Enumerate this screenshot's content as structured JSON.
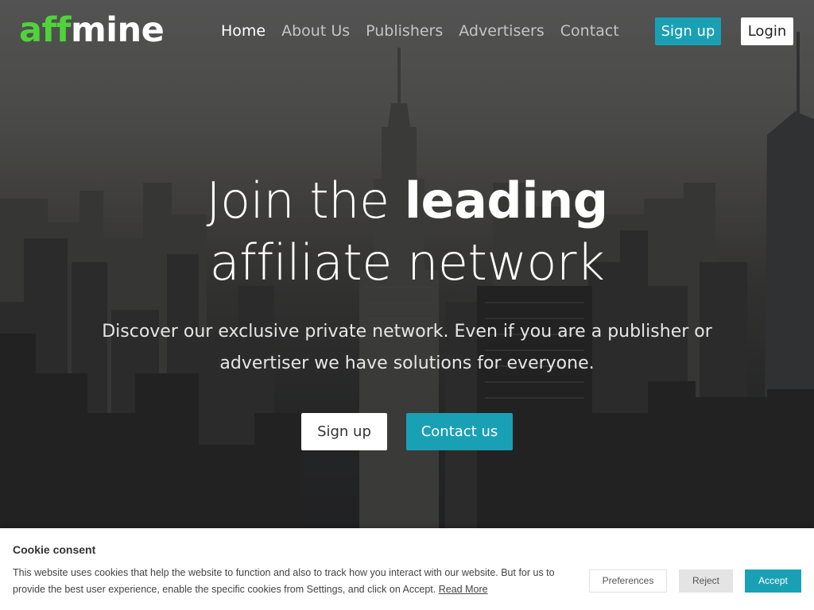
{
  "brand": {
    "logo_part1": "aff",
    "logo_part2": "mine",
    "logo_accent_color": "#4fd33b"
  },
  "nav": {
    "links": [
      {
        "label": "Home",
        "active": true
      },
      {
        "label": "About Us",
        "active": false
      },
      {
        "label": "Publishers",
        "active": false
      },
      {
        "label": "Advertisers",
        "active": false
      },
      {
        "label": "Contact",
        "active": false
      }
    ],
    "signup_label": "Sign up",
    "login_label": "Login"
  },
  "hero": {
    "headline_part1": "Join the ",
    "headline_strong": "leading",
    "headline_line2": "affiliate network",
    "subtext": "Discover our exclusive private network. Even if you are a publisher or advertiser we have solutions for everyone.",
    "signup_label": "Sign up",
    "contact_label": "Contact us"
  },
  "cookie": {
    "title": "Cookie consent",
    "text": "This website uses cookies that help the website to function and also to track how you interact with our website. But for us to provide the best user experience, enable the specific cookies from Settings, and click on Accept.",
    "read_more": "Read More",
    "preferences_label": "Preferences",
    "reject_label": "Reject",
    "accept_label": "Accept"
  },
  "colors": {
    "accent": "#1aa0b4",
    "white": "#ffffff"
  }
}
